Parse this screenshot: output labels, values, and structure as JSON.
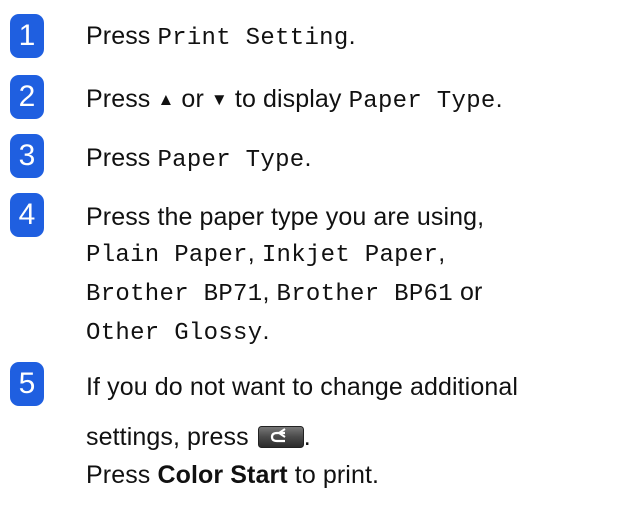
{
  "steps": [
    {
      "number": "1",
      "parts": [
        "Press ",
        "Print Setting",
        "."
      ]
    },
    {
      "number": "2",
      "parts": [
        "Press ",
        "▲",
        " or ",
        "▼",
        " to display ",
        "Paper Type",
        "."
      ]
    },
    {
      "number": "3",
      "parts": [
        "Press ",
        "Paper Type",
        "."
      ]
    },
    {
      "number": "4",
      "line1": "Press the paper type you are using,",
      "opt1": "Plain Paper",
      "sep1": ", ",
      "opt2": "Inkjet Paper",
      "sep2": ",",
      "opt3": "Brother BP71",
      "sep3": ", ",
      "opt4": "Brother BP61",
      "or_text": " or",
      "opt5": "Other Glossy",
      "end": "."
    },
    {
      "number": "5",
      "line1": "If you do not want to change additional",
      "line2_prefix": "settings, press ",
      "line2_suffix": ".",
      "line3_prefix": "Press ",
      "line3_bold": "Color Start",
      "line3_suffix": " to print."
    }
  ],
  "colors": {
    "badge": "#1f5fe0",
    "text": "#111111"
  },
  "icons": {
    "back_button": "back-arrow-button-icon"
  }
}
